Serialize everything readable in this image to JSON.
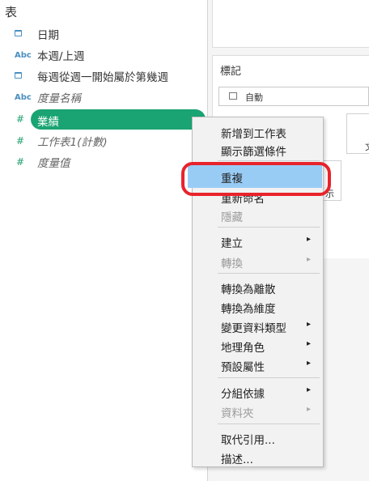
{
  "data_pane": {
    "section_title": "表",
    "fields": [
      {
        "icon": "calendar-icon",
        "label": "日期",
        "italic": false
      },
      {
        "icon": "abc-icon",
        "icon_text": "Abc",
        "label": "本週/上週",
        "italic": false
      },
      {
        "icon": "calendar-icon",
        "label": "每週從週一開始屬於第幾週",
        "italic": false
      },
      {
        "icon": "abc-icon",
        "icon_text": "Abc",
        "label": "度量名稱",
        "italic": true
      },
      {
        "icon": "measure-icon",
        "icon_text": "#",
        "label": "業績",
        "italic": false,
        "selected": true
      },
      {
        "icon": "measure-icon",
        "icon_text": "#",
        "label": "工作表1(計數)",
        "italic": true
      },
      {
        "icon": "measure-icon",
        "icon_text": "#",
        "label": "度量值",
        "italic": true
      }
    ]
  },
  "marks": {
    "title": "標記",
    "mark_type": "自動",
    "button_partial_1": "文",
    "button_partial_2": "示"
  },
  "context_menu": {
    "items": [
      {
        "label": "新增到工作表",
        "enabled": true,
        "submenu": false
      },
      {
        "label": "顯示篩選條件",
        "enabled": true,
        "submenu": false
      },
      {
        "label": "重複",
        "enabled": true,
        "submenu": false,
        "highlighted": true
      },
      {
        "label": "重新命名",
        "enabled": true,
        "submenu": false
      },
      {
        "label": "隱藏",
        "enabled": false,
        "submenu": false
      },
      {
        "label": "建立",
        "enabled": true,
        "submenu": true
      },
      {
        "label": "轉換",
        "enabled": false,
        "submenu": true
      },
      {
        "label": "轉換為離散",
        "enabled": true,
        "submenu": false
      },
      {
        "label": "轉換為維度",
        "enabled": true,
        "submenu": false
      },
      {
        "label": "變更資料類型",
        "enabled": true,
        "submenu": true
      },
      {
        "label": "地理角色",
        "enabled": true,
        "submenu": true
      },
      {
        "label": "預設屬性",
        "enabled": true,
        "submenu": true
      },
      {
        "label": "分組依據",
        "enabled": true,
        "submenu": true
      },
      {
        "label": "資料夾",
        "enabled": false,
        "submenu": true
      },
      {
        "label": "取代引用...",
        "enabled": true,
        "submenu": false
      },
      {
        "label": "描述...",
        "enabled": true,
        "submenu": false
      }
    ],
    "submenu_arrow": "▸"
  },
  "colors": {
    "selected_pill": "#1aa473",
    "menu_highlight": "#99ccf5",
    "annotation_ring": "#e8232b",
    "dimension_icon": "#4a8fc0",
    "measure_icon": "#1fa06e"
  }
}
